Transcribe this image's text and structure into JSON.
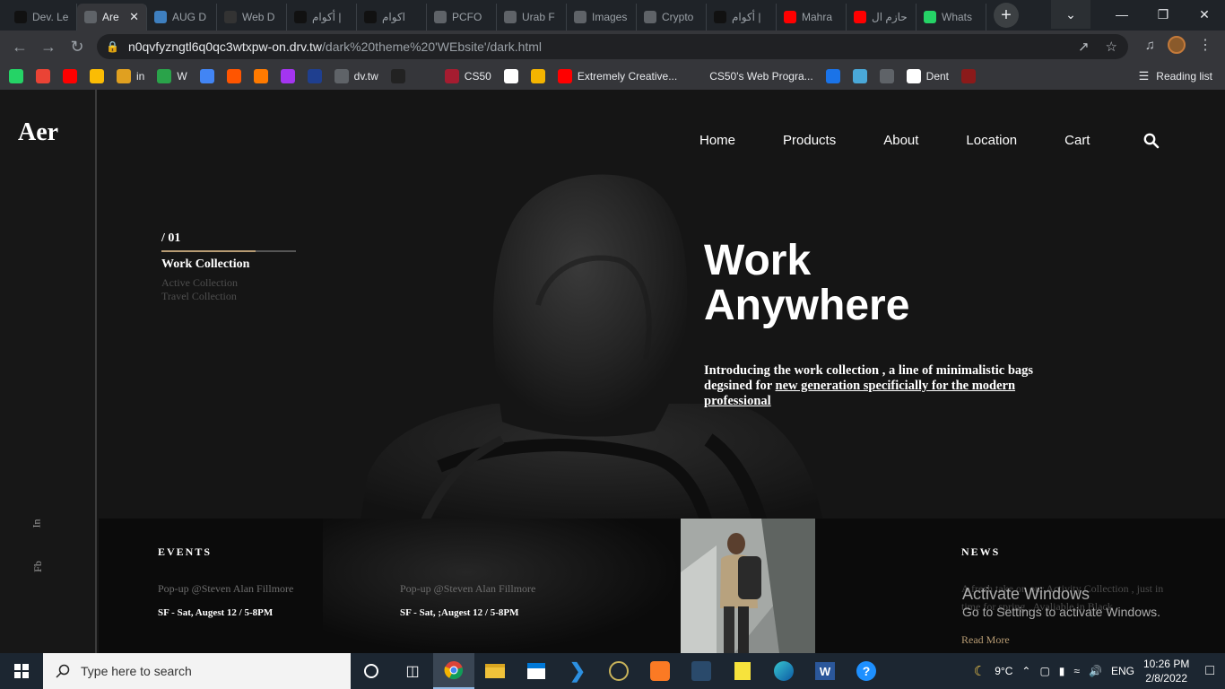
{
  "browser": {
    "tabs": [
      {
        "label": "Dev. Le",
        "icon": "code-icon",
        "color": "#111111"
      },
      {
        "label": "Are",
        "icon": "globe-icon",
        "color": "#5f6368",
        "active": true
      },
      {
        "label": "AUG D",
        "icon": "flag-icon",
        "color": "#3e7fbf"
      },
      {
        "label": "Web D",
        "icon": "chatgpt-icon",
        "color": "#333333"
      },
      {
        "label": "أكوام |",
        "icon": "akwam-icon",
        "color": "#111111"
      },
      {
        "label": "اكوام",
        "icon": "akwam-icon",
        "color": "#111111"
      },
      {
        "label": "PCFO",
        "icon": "globe-icon",
        "color": "#5f6368"
      },
      {
        "label": "Urab F",
        "icon": "globe-icon",
        "color": "#5f6368"
      },
      {
        "label": "Images",
        "icon": "globe-icon",
        "color": "#5f6368"
      },
      {
        "label": "Crypto",
        "icon": "globe-icon",
        "color": "#5f6368"
      },
      {
        "label": "أكوام |",
        "icon": "akwam-icon",
        "color": "#111111"
      },
      {
        "label": "Mahra",
        "icon": "youtube-icon",
        "color": "#ff0000"
      },
      {
        "label": "حازم ال",
        "icon": "youtube-icon",
        "color": "#ff0000"
      },
      {
        "label": "Whats",
        "icon": "whatsapp-icon",
        "color": "#25d366"
      }
    ],
    "new_tab_label": "+",
    "url_host": "n0qvfyzngtl6q0qc3wtxpw-on.drv.tw",
    "url_path": "/dark%20theme%20'WEbsite'/dark.html",
    "bookmarks": [
      {
        "label": "",
        "icon": "whatsapp-icon",
        "color": "#25d366"
      },
      {
        "label": "",
        "icon": "gmail-icon",
        "color": "#ea4335"
      },
      {
        "label": "",
        "icon": "youtube-icon",
        "color": "#ff0000"
      },
      {
        "label": "",
        "icon": "drive-icon",
        "color": "#fbbc04"
      },
      {
        "label": "in",
        "icon": "in-icon",
        "color": "#e0a020"
      },
      {
        "label": "W",
        "icon": "w-icon",
        "color": "#2aa34a"
      },
      {
        "label": "",
        "icon": "translate-icon",
        "color": "#4285f4"
      },
      {
        "label": "",
        "icon": "soundcloud-icon",
        "color": "#ff5500"
      },
      {
        "label": "",
        "icon": "fox-icon",
        "color": "#ff7a00"
      },
      {
        "label": "",
        "icon": "udemy-icon",
        "color": "#a435f0"
      },
      {
        "label": "",
        "icon": "circle-icon",
        "color": "#1f3f8f"
      },
      {
        "label": "dv.tw",
        "icon": "globe-icon",
        "color": "#5f6368"
      },
      {
        "label": "",
        "icon": "dark-icon",
        "color": "#222222"
      },
      {
        "label": "",
        "icon": "x-icon",
        "color": "#35363a"
      },
      {
        "label": "CS50",
        "icon": "harvard-icon",
        "color": "#a51c30"
      },
      {
        "label": "",
        "icon": "wix-icon",
        "color": "#ffffff"
      },
      {
        "label": "",
        "icon": "note-icon",
        "color": "#f4b400"
      },
      {
        "label": "Extremely Creative...",
        "icon": "youtube-icon",
        "color": "#ff0000"
      },
      {
        "label": "CS50's Web Progra...",
        "icon": "x-icon",
        "color": "#35363a"
      },
      {
        "label": "",
        "icon": "c-icon",
        "color": "#1a73e8"
      },
      {
        "label": "",
        "icon": "bird-icon",
        "color": "#4aa8d8"
      },
      {
        "label": "",
        "icon": "globe-icon",
        "color": "#5f6368"
      },
      {
        "label": "Dent",
        "icon": "dent-icon",
        "color": "#ffffff"
      },
      {
        "label": "",
        "icon": "mask-icon",
        "color": "#8b1a1a"
      }
    ],
    "reading_list": "Reading list"
  },
  "site": {
    "logo": "Aer",
    "nav": [
      "Home",
      "Products",
      "About",
      "Location",
      "Cart"
    ],
    "social": [
      "In",
      "Fb"
    ],
    "collection_number": "/ 01",
    "collection_active": "Work Collection",
    "collection_others": [
      "Active Collection",
      "Travel Collection"
    ],
    "hero_title_line1": "Work",
    "hero_title_line2": "Anywhere",
    "hero_desc_plain": "Introducing the work collection , a line of minimalistic bags degsined for ",
    "hero_desc_link": "new generation specificially for the modern professional",
    "events_title": "EVENTS",
    "events": [
      {
        "venue": "Pop-up @Steven Alan Fillmore",
        "date": "SF - Sat, Augest 12 / 5-8PM"
      },
      {
        "venue": "Pop-up @Steven Alan Fillmore",
        "date": "SF - Sat, ;Augest 12 / 5-8PM"
      }
    ],
    "news_title": "NEWS",
    "news_text": "A fresh take on our Activity Collection , just in time for spring , Avaliable in Black",
    "read_more": "Read More",
    "accent_color": "#b79b73"
  },
  "watermark": {
    "line1": "Activate Windows",
    "line2": "Go to Settings to activate Windows."
  },
  "taskbar": {
    "search_placeholder": "Type here to search",
    "weather": "9°C",
    "language": "ENG",
    "time": "10:26 PM",
    "date": "2/8/2022"
  }
}
